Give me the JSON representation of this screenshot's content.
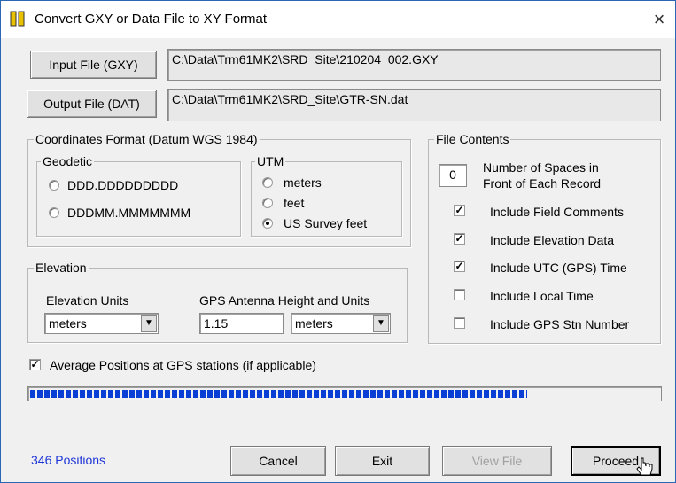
{
  "window": {
    "title": "Convert GXY or Data File to XY Format",
    "close_icon": "×"
  },
  "files": {
    "input_button": "Input File (GXY)",
    "input_path": "C:\\Data\\Trm61MK2\\SRD_Site\\210204_002.GXY",
    "output_button": "Output File (DAT)",
    "output_path": "C:\\Data\\Trm61MK2\\SRD_Site\\GTR-SN.dat"
  },
  "coords": {
    "group_label": "Coordinates Format (Datum WGS 1984)",
    "geodetic_label": "Geodetic",
    "geodetic_options": [
      "DDD.DDDDDDDDD",
      "DDDMM.MMMMMMM"
    ],
    "utm_label": "UTM",
    "utm_options": [
      "meters",
      "feet",
      "US Survey feet"
    ],
    "utm_selected": "US Survey feet"
  },
  "elevation": {
    "group_label": "Elevation",
    "units_label": "Elevation Units",
    "units_value": "meters",
    "antenna_label": "GPS Antenna Height and Units",
    "antenna_height": "1.15",
    "antenna_units": "meters"
  },
  "file_contents": {
    "group_label": "File Contents",
    "spaces_value": "0",
    "spaces_label_line1": "Number of Spaces in",
    "spaces_label_line2": "Front of Each Record",
    "options": [
      {
        "label": "Include Field Comments",
        "checked": true
      },
      {
        "label": "Include Elevation Data",
        "checked": true
      },
      {
        "label": "Include UTC (GPS) Time",
        "checked": true
      },
      {
        "label": "Include Local Time",
        "checked": false
      },
      {
        "label": "Include GPS Stn Number",
        "checked": false
      }
    ]
  },
  "average": {
    "label": "Average Positions at GPS stations (if applicable)",
    "checked": true
  },
  "progress": {
    "fraction": 0.79
  },
  "status_text": "346 Positions",
  "buttons": {
    "cancel": "Cancel",
    "exit": "Exit",
    "view_file": "View File",
    "proceed": "Proceed"
  },
  "colors": {
    "accent_blue": "#0a3fd6",
    "status_blue": "#1d35d8",
    "app_icon_yellow": "#e8c200"
  }
}
